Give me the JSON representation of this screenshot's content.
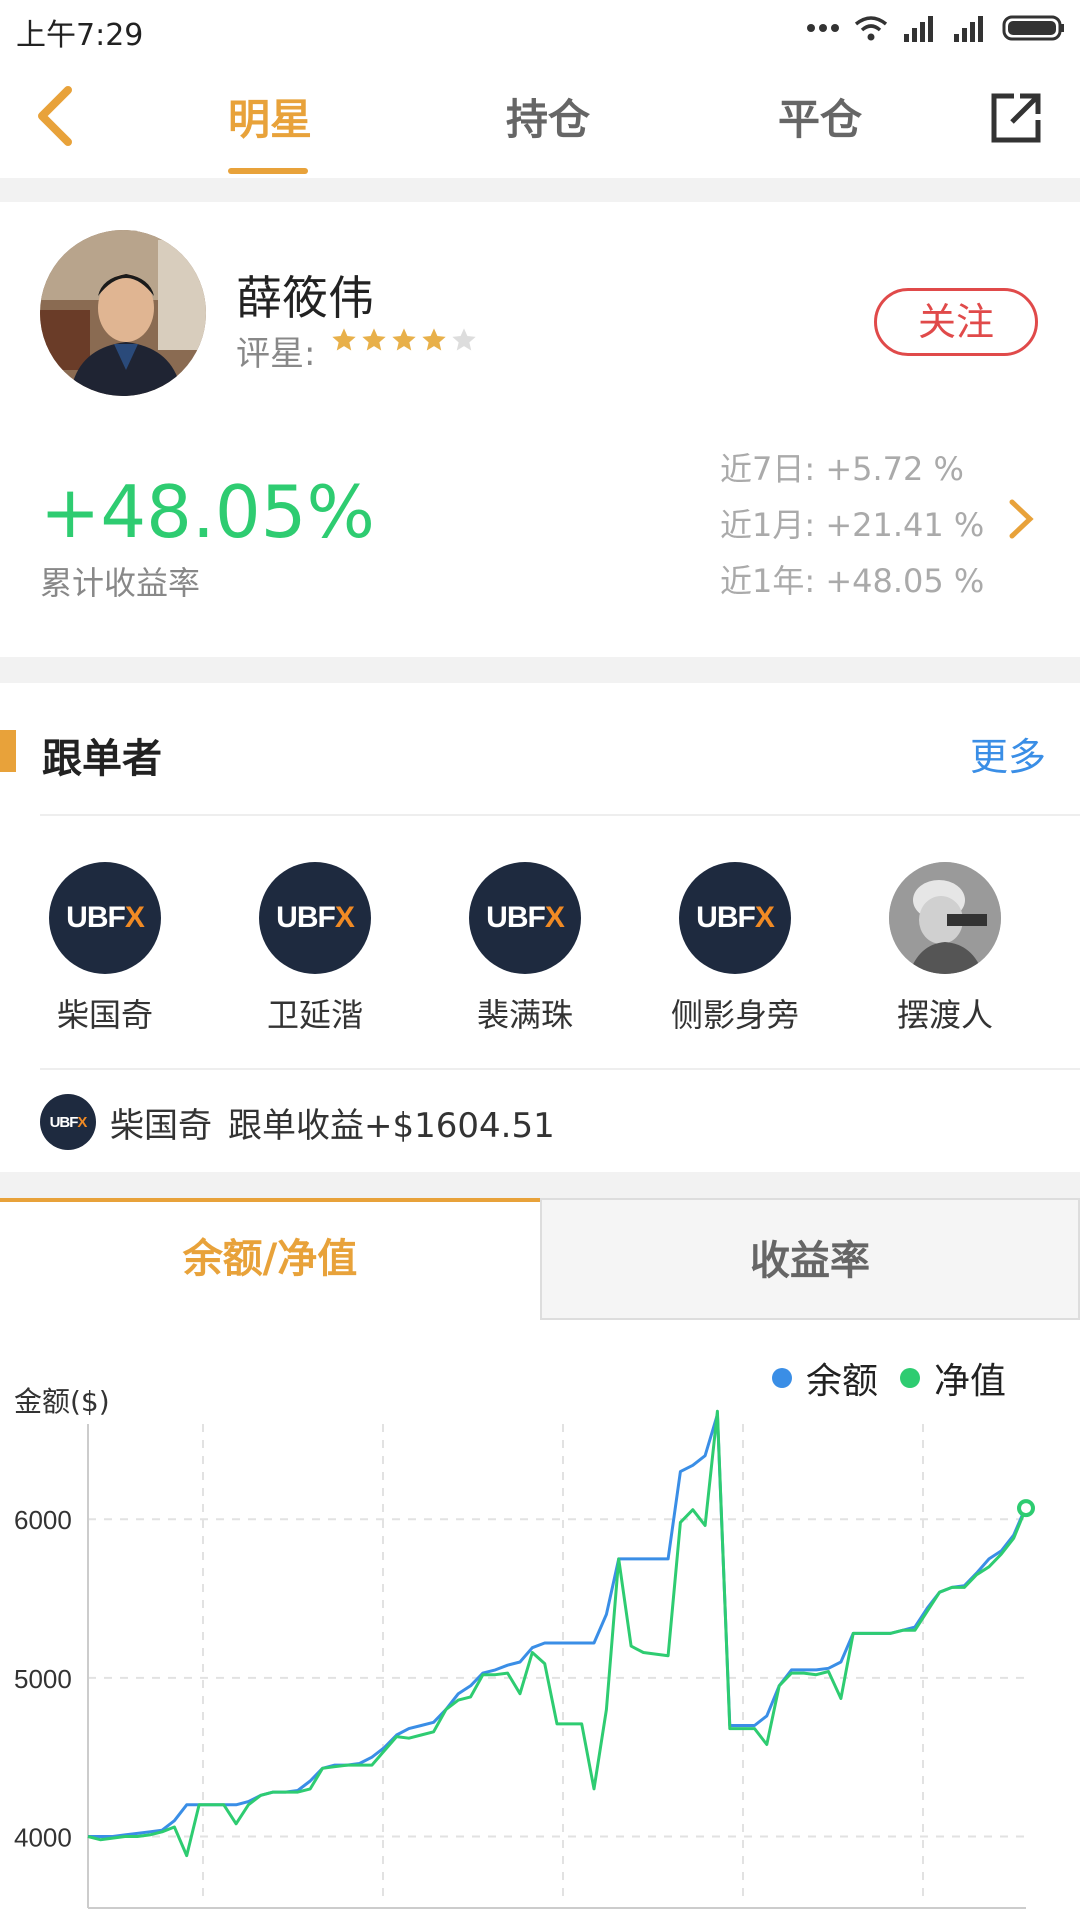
{
  "status_bar": {
    "time": "上午7:29"
  },
  "nav": {
    "tabs": [
      {
        "label": "明星"
      },
      {
        "label": "持仓"
      },
      {
        "label": "平仓"
      }
    ],
    "active_tab": "明星"
  },
  "profile": {
    "name": "薛筱伟",
    "rating_label": "评星:",
    "rating": 4,
    "rating_max": 5,
    "follow_label": "关注",
    "total_return": "+48.05%",
    "total_return_label": "累计收益率",
    "periods": [
      {
        "label": "近7日: +5.72 %"
      },
      {
        "label": "近1月: +21.41 %"
      },
      {
        "label": "近1年: +48.05 %"
      }
    ]
  },
  "followers": {
    "title": "跟单者",
    "more_label": "更多",
    "logo_text": "UBF",
    "logo_accent": "X",
    "items": [
      {
        "name": "柴国奇",
        "avatar": "ubfx-logo"
      },
      {
        "name": "卫延湝",
        "avatar": "ubfx-logo"
      },
      {
        "name": "裴满珠",
        "avatar": "ubfx-logo"
      },
      {
        "name": "侧影身旁",
        "avatar": "ubfx-logo"
      },
      {
        "name": "摆渡人",
        "avatar": "photo"
      }
    ],
    "profit": {
      "name": "柴国奇",
      "text": "跟单收益+$1604.51"
    }
  },
  "chart_tabs": [
    {
      "label": "余额/净值"
    },
    {
      "label": "收益率"
    }
  ],
  "colors": {
    "accent": "#e8a23a",
    "positive": "#2ecc71",
    "follow": "#e04a4a",
    "link": "#3a8ee6",
    "balance": "#3a8ee6",
    "equity": "#2ecc71"
  },
  "chart_data": {
    "type": "line",
    "ylabel": "金额($)",
    "ylim": [
      3600,
      6600
    ],
    "yticks": [
      4000,
      5000,
      6000
    ],
    "grid": true,
    "legend_placement": "top-right",
    "series": [
      {
        "name": "余额",
        "color": "#3a8ee6",
        "values": [
          4000,
          4000,
          4000,
          4010,
          4020,
          4030,
          4040,
          4100,
          4200,
          4200,
          4200,
          4200,
          4200,
          4220,
          4260,
          4280,
          4280,
          4290,
          4350,
          4430,
          4450,
          4450,
          4460,
          4500,
          4560,
          4640,
          4680,
          4700,
          4720,
          4800,
          4900,
          4950,
          5030,
          5050,
          5080,
          5100,
          5190,
          5220,
          5220,
          5220,
          5220,
          5220,
          5400,
          5750,
          5750,
          5750,
          5750,
          5750,
          6300,
          6340,
          6400,
          6660,
          4700,
          4700,
          4700,
          4760,
          4950,
          5050,
          5050,
          5050,
          5060,
          5100,
          5280,
          5280,
          5280,
          5280,
          5300,
          5320,
          5440,
          5540,
          5570,
          5580,
          5660,
          5750,
          5800,
          5900,
          6080
        ]
      },
      {
        "name": "净值",
        "color": "#2ecc71",
        "values": [
          4000,
          3980,
          3990,
          4000,
          4000,
          4010,
          4030,
          4060,
          3880,
          4200,
          4200,
          4200,
          4080,
          4200,
          4260,
          4280,
          4280,
          4280,
          4300,
          4430,
          4440,
          4450,
          4450,
          4450,
          4540,
          4630,
          4620,
          4640,
          4660,
          4800,
          4860,
          4880,
          5020,
          5020,
          5030,
          4900,
          5160,
          5090,
          4710,
          4710,
          4710,
          4300,
          4800,
          5750,
          5200,
          5160,
          5150,
          5140,
          5980,
          6060,
          5960,
          6680,
          4680,
          4680,
          4680,
          4580,
          4950,
          5030,
          5030,
          5020,
          5040,
          4870,
          5280,
          5280,
          5280,
          5280,
          5300,
          5300,
          5420,
          5540,
          5570,
          5570,
          5650,
          5700,
          5780,
          5880,
          6070
        ]
      }
    ]
  }
}
